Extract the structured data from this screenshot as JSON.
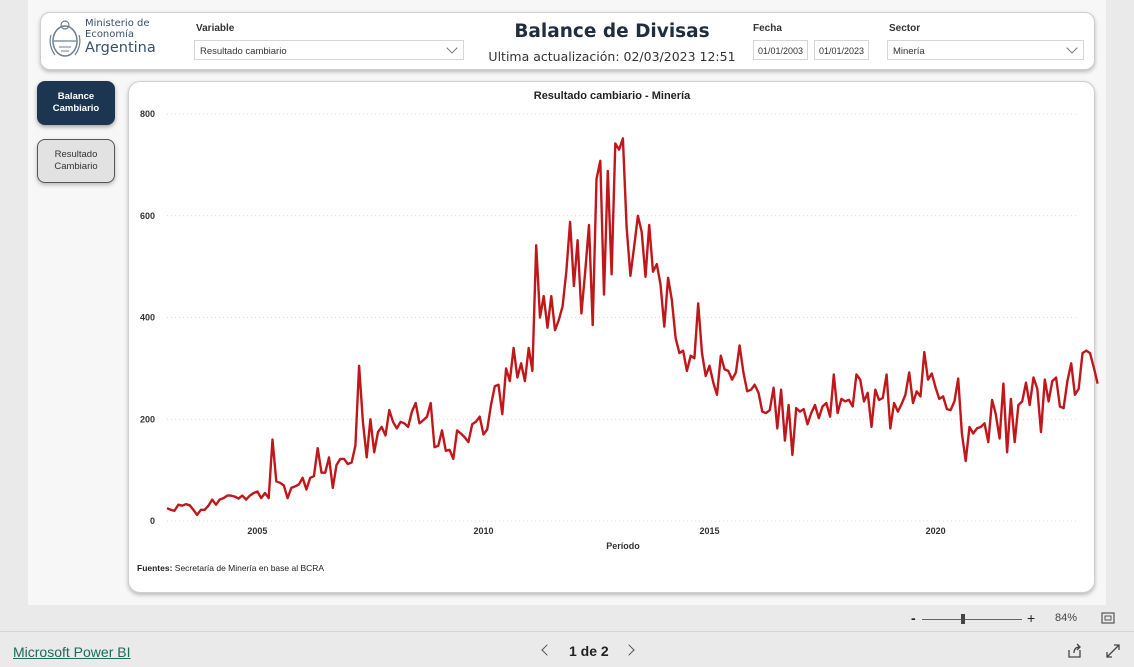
{
  "logo": {
    "line1": "Ministerio de",
    "line2": "Economía",
    "line3": "Argentina"
  },
  "header": {
    "title": "Balance de Divisas",
    "updated": "Ultima actualización: 02/03/2023 12:51"
  },
  "filters": {
    "variable_label": "Variable",
    "variable_value": "Resultado cambiario",
    "fecha_label": "Fecha",
    "fecha_from": "01/01/2003",
    "fecha_to": "01/01/2023",
    "sector_label": "Sector",
    "sector_value": "Minería"
  },
  "nav": {
    "active_label": "Balance\nCambiario",
    "inactive_label": "Resultado\nCambiario"
  },
  "source": {
    "label": "Fuentes:",
    "text": " Secretaría de Minería en base al BCRA"
  },
  "zoom": {
    "minus": "-",
    "plus": "+",
    "level": "84%"
  },
  "footer": {
    "brand": "Microsoft Power BI",
    "page": "1 de 2"
  },
  "colors": {
    "series": "#c0171b",
    "nav_active": "#1c3550",
    "brand_link": "#1a6b57"
  },
  "chart_data": {
    "type": "line",
    "title": "Resultado cambiario - Minería",
    "xlabel": "Período",
    "ylabel": "",
    "ylim": [
      0,
      800
    ],
    "yticks": [
      0,
      200,
      400,
      600,
      800
    ],
    "xticks": [
      2005,
      2010,
      2015,
      2020
    ],
    "grid": true,
    "x_start": 2003.0,
    "x_step": 0.08333,
    "series": [
      {
        "values": [
          25,
          22,
          20,
          32,
          30,
          33,
          31,
          22,
          12,
          22,
          22,
          30,
          42,
          32,
          42,
          45,
          50,
          50,
          48,
          44,
          50,
          42,
          50,
          55,
          58,
          45,
          55,
          45,
          160,
          78,
          75,
          70,
          45,
          65,
          68,
          72,
          85,
          62,
          85,
          88,
          143,
          95,
          95,
          125,
          65,
          110,
          122,
          122,
          112,
          115,
          148,
          305,
          195,
          125,
          200,
          135,
          175,
          185,
          168,
          218,
          195,
          182,
          195,
          192,
          185,
          215,
          232,
          192,
          198,
          205,
          232,
          145,
          148,
          178,
          138,
          140,
          122,
          178,
          172,
          165,
          155,
          190,
          195,
          205,
          170,
          180,
          228,
          265,
          268,
          210,
          300,
          275,
          340,
          282,
          310,
          275,
          340,
          295,
          542,
          400,
          442,
          380,
          442,
          375,
          395,
          422,
          490,
          588,
          462,
          552,
          408,
          490,
          582,
          385,
          672,
          708,
          445,
          688,
          485,
          742,
          730,
          752,
          578,
          482,
          540,
          600,
          568,
          480,
          582,
          490,
          505,
          465,
          382,
          478,
          435,
          360,
          330,
          335,
          295,
          325,
          320,
          428,
          330,
          285,
          305,
          272,
          248,
          325,
          298,
          295,
          278,
          292,
          345,
          292,
          255,
          258,
          268,
          252,
          215,
          212,
          218,
          262,
          182,
          258,
          158,
          228,
          130,
          222,
          215,
          220,
          190,
          212,
          228,
          202,
          225,
          232,
          205,
          288,
          212,
          240,
          235,
          238,
          225,
          288,
          278,
          235,
          252,
          185,
          258,
          238,
          242,
          288,
          182,
          232,
          215,
          230,
          248,
          292,
          232,
          255,
          245,
          332,
          278,
          290,
          262,
          240,
          245,
          220,
          218,
          235,
          280,
          172,
          118,
          185,
          172,
          182,
          185,
          192,
          155,
          238,
          210,
          162,
          270,
          135,
          240,
          155,
          228,
          235,
          272,
          228,
          282,
          260,
          175,
          278,
          235,
          275,
          282,
          225,
          222,
          275,
          310,
          248,
          260,
          330,
          335,
          330,
          302,
          270
        ]
      }
    ]
  }
}
